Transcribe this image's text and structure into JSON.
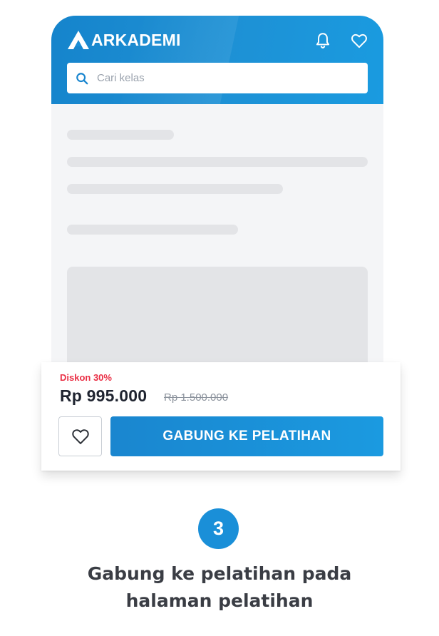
{
  "header": {
    "logo_text": "ARKADEMI",
    "icons": [
      "bell-icon",
      "heart-icon"
    ]
  },
  "search": {
    "placeholder": "Cari kelas",
    "icon": "search-icon"
  },
  "colors": {
    "brand_blue": "#1a8fd8",
    "discount_red": "#ea2f45",
    "skeleton": "#e3e4e7",
    "background": "#f4f5f7"
  },
  "pricing": {
    "discount_label": "Diskon 30%",
    "price": "Rp 995.000",
    "original_price": "Rp 1.500.000"
  },
  "actions": {
    "wishlist_icon": "heart-icon",
    "join_label": "GABUNG KE PELATIHAN"
  },
  "step": {
    "number": "3",
    "caption_line1": "Gabung ke pelatihan pada",
    "caption_line2": "halaman pelatihan"
  }
}
